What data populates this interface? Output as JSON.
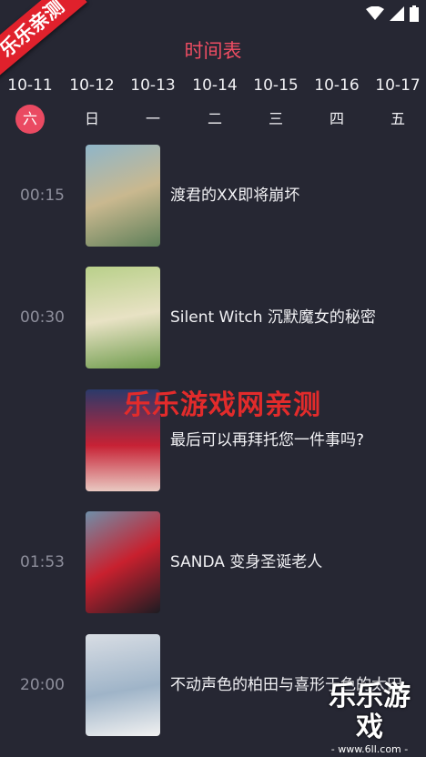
{
  "badge": "乐乐亲测",
  "title": "时间表",
  "dates": [
    "10-11",
    "10-12",
    "10-13",
    "10-14",
    "10-15",
    "10-16",
    "10-17"
  ],
  "weekdays": [
    "六",
    "日",
    "一",
    "二",
    "三",
    "四",
    "五"
  ],
  "active_day_index": 0,
  "shows": [
    {
      "time": "00:15",
      "name": "渡君的XX即将崩坏",
      "thumb_colors": [
        "#8fb6c9",
        "#c9b88f",
        "#5e7f59"
      ]
    },
    {
      "time": "00:30",
      "name": "Silent Witch 沉默魔女的秘密",
      "thumb_colors": [
        "#b9d08a",
        "#e8e2c4",
        "#6f9c4d"
      ]
    },
    {
      "time": "",
      "name": "最后可以再拜托您一件事吗?",
      "thumb_colors": [
        "#2b3a6a",
        "#c72235",
        "#e9c9c2"
      ]
    },
    {
      "time": "01:53",
      "name": "SANDA 变身圣诞老人",
      "thumb_colors": [
        "#6f8fa9",
        "#c8202e",
        "#1c1c22"
      ]
    },
    {
      "time": "20:00",
      "name": "不动声色的柏田与喜形于色的太田",
      "thumb_colors": [
        "#d8dde4",
        "#9fb4c8",
        "#f1f1f1"
      ]
    }
  ],
  "watermarks": {
    "middle": "乐乐游戏网亲测",
    "corner_title": "乐乐游戏",
    "corner_url": "- www.6ll.com -"
  },
  "colors": {
    "accent": "#ea4a62",
    "background": "#262733"
  }
}
